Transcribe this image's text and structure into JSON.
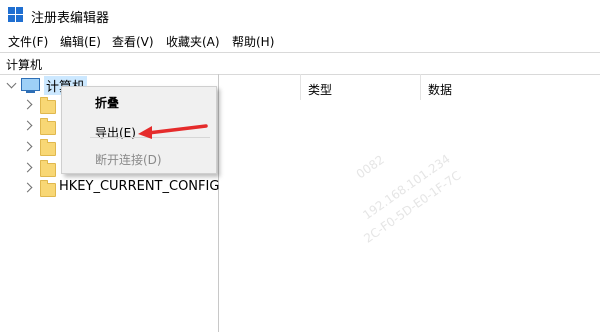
{
  "window": {
    "title": "注册表编辑器"
  },
  "menu": [
    "文件(F)",
    "编辑(E)",
    "查看(V)",
    "收藏夹(A)",
    "帮助(H)"
  ],
  "address": "计算机",
  "tree": {
    "root_label": "计算机",
    "hkey_current_config": "HKEY_CURRENT_CONFIG"
  },
  "list_headers": {
    "type": "类型",
    "data": "数据"
  },
  "context_menu": {
    "collapse": "折叠",
    "export": "导出(E)",
    "disconnect": "断开连接(D)"
  },
  "watermark": [
    "0082",
    "192.168.101.234",
    "2C-F0-5D-E0-1F-7C"
  ],
  "colors": {
    "arrow": "#e52b2b",
    "folder": "#f8d775",
    "selection_text": "#000000"
  }
}
